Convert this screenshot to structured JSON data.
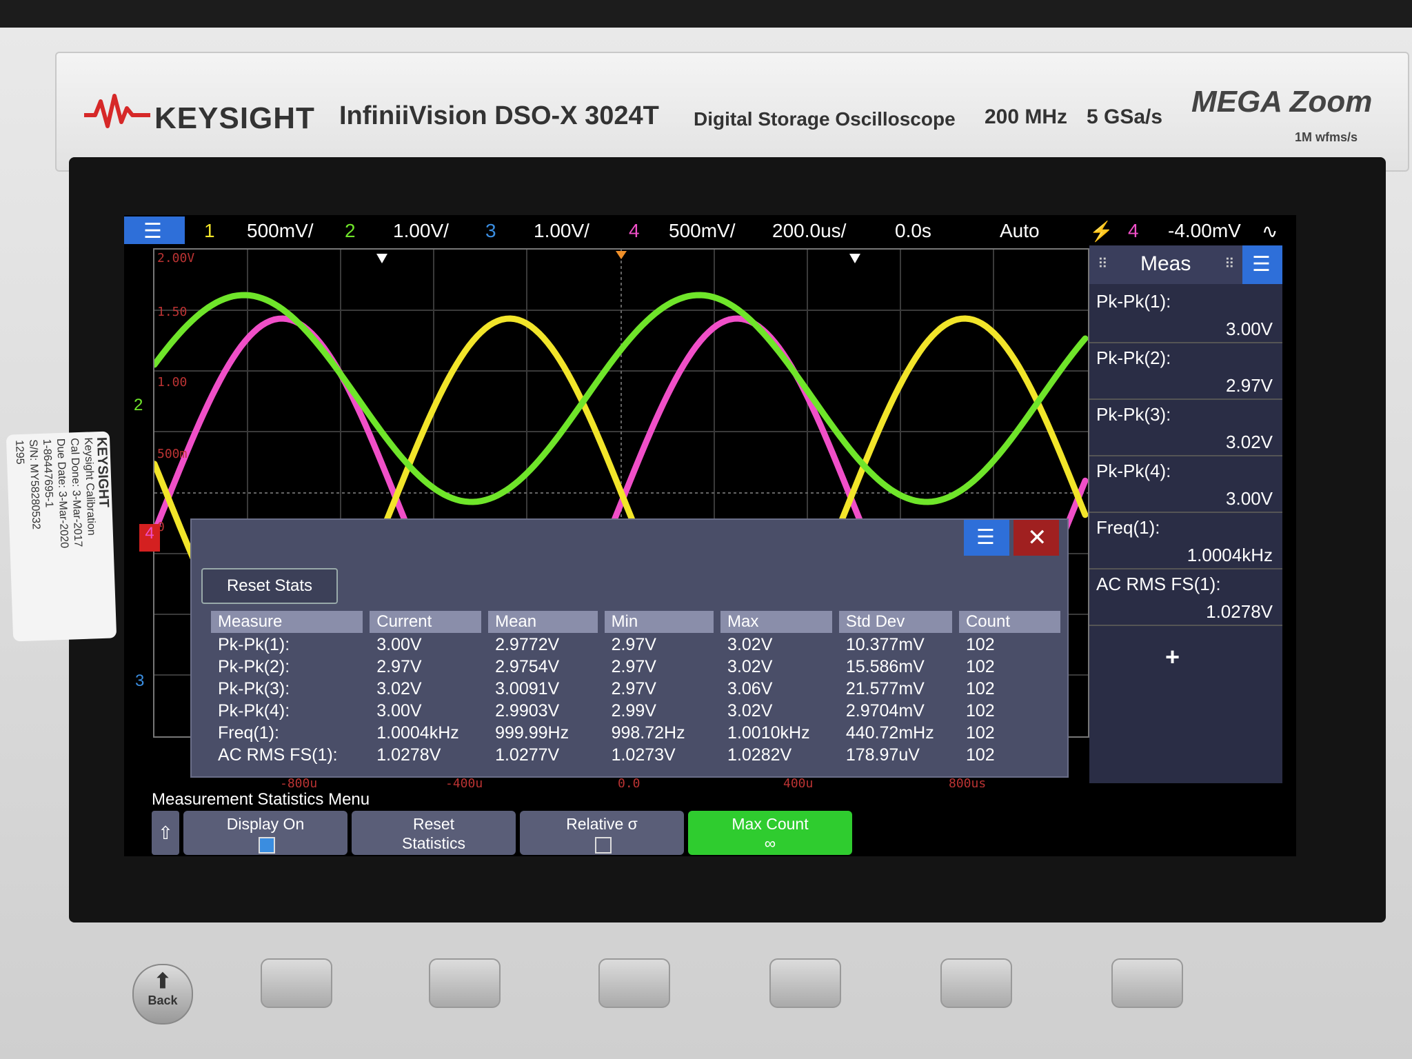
{
  "brand": {
    "name": "KEYSIGHT",
    "model": "InfiniiVision DSO-X 3024T",
    "description": "Digital Storage Oscilloscope",
    "bandwidth": "200 MHz",
    "sample_rate": "5 GSa/s",
    "megazoom": "MEGA Zoom",
    "megazoom_sub": "1M wfms/s"
  },
  "sticker": {
    "brand": "KEYSIGHT",
    "line1": "Keysight Calibration",
    "line2": "Cal Done:  3-Mar-2017",
    "line3": "Due Date:  3-Mar-2020",
    "line4": "1-86447695-1",
    "line5": "S/N: MY58280532",
    "line6": "1295"
  },
  "colors": {
    "ch1": "#f2e52a",
    "ch2": "#6fe52a",
    "ch3": "#3a8de0",
    "ch4": "#f04fc8",
    "accent_blue": "#2e6fd9",
    "active_green": "#2fcc2f"
  },
  "status": {
    "ch1": {
      "num": "1",
      "scale": "500mV/"
    },
    "ch2": {
      "num": "2",
      "scale": "1.00V/"
    },
    "ch3": {
      "num": "3",
      "scale": "1.00V/"
    },
    "ch4": {
      "num": "4",
      "scale": "500mV/"
    },
    "timebase": "200.0us/",
    "delay": "0.0s",
    "trigger_mode": "Auto",
    "trigger_source": "4",
    "trigger_level": "-4.00mV"
  },
  "graticule": {
    "y_labels": [
      "2.00V",
      "1.50",
      "1.00",
      "500m",
      "0"
    ],
    "x_labels": [
      "-800u",
      "-400u",
      "0.0",
      "400u",
      "800us"
    ]
  },
  "markers": {
    "ch2": "2",
    "ch4": "4",
    "ch3": "3"
  },
  "meas_panel": {
    "title": "Meas",
    "items": [
      {
        "label": "Pk-Pk(1):",
        "value": "3.00V"
      },
      {
        "label": "Pk-Pk(2):",
        "value": "2.97V"
      },
      {
        "label": "Pk-Pk(3):",
        "value": "3.02V"
      },
      {
        "label": "Pk-Pk(4):",
        "value": "3.00V"
      },
      {
        "label": "Freq(1):",
        "value": "1.0004kHz"
      },
      {
        "label": "AC RMS FS(1):",
        "value": "1.0278V"
      }
    ],
    "add": "+"
  },
  "stats": {
    "reset_label": "Reset Stats",
    "headers": [
      "Measure",
      "Current",
      "Mean",
      "Min",
      "Max",
      "Std Dev",
      "Count"
    ],
    "rows": [
      [
        "Pk-Pk(1):",
        "3.00V",
        "2.9772V",
        "2.97V",
        "3.02V",
        "10.377mV",
        "102"
      ],
      [
        "Pk-Pk(2):",
        "2.97V",
        "2.9754V",
        "2.97V",
        "3.02V",
        "15.586mV",
        "102"
      ],
      [
        "Pk-Pk(3):",
        "3.02V",
        "3.0091V",
        "2.97V",
        "3.06V",
        "21.577mV",
        "102"
      ],
      [
        "Pk-Pk(4):",
        "3.00V",
        "2.9903V",
        "2.99V",
        "3.02V",
        "2.9704mV",
        "102"
      ],
      [
        "Freq(1):",
        "1.0004kHz",
        "999.99Hz",
        "998.72Hz",
        "1.0010kHz",
        "440.72mHz",
        "102"
      ],
      [
        "AC RMS FS(1):",
        "1.0278V",
        "1.0277V",
        "1.0273V",
        "1.0282V",
        "178.97uV",
        "102"
      ]
    ]
  },
  "softkeys": {
    "menu_title": "Measurement Statistics Menu",
    "display_on": {
      "label": "Display On",
      "checked": true
    },
    "reset": {
      "line1": "Reset",
      "line2": "Statistics"
    },
    "relative": {
      "label": "Relative σ",
      "checked": false
    },
    "max_count": {
      "label": "Max Count",
      "value": "∞"
    }
  },
  "front_panel": {
    "back_label": "Back"
  }
}
